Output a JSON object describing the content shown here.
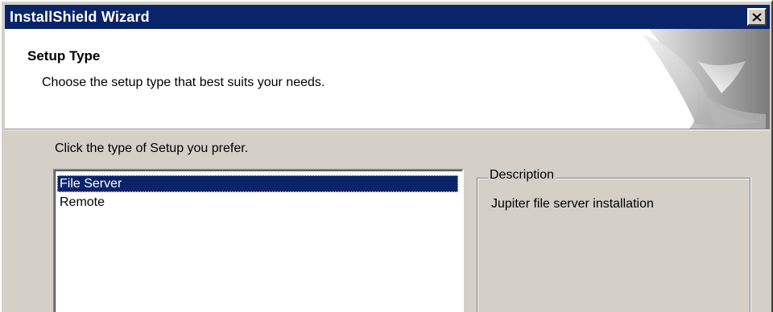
{
  "window": {
    "title": "InstallShield Wizard"
  },
  "icons": {
    "close": "close-icon",
    "header_graphic": "page-curl-graphic"
  },
  "header": {
    "title": "Setup Type",
    "subtitle": "Choose the setup type that best suits your needs."
  },
  "main": {
    "instruction": "Click the type of Setup you prefer.",
    "setup_types": [
      {
        "label": "File Server",
        "selected": true
      },
      {
        "label": "Remote",
        "selected": false
      }
    ],
    "description": {
      "legend": "Description",
      "text": "Jupiter file server installation"
    }
  },
  "colors": {
    "titlebar": "#0a246a",
    "selection": "#0a246a",
    "face": "#d4d0c8",
    "header_bg": "#ffffff"
  }
}
